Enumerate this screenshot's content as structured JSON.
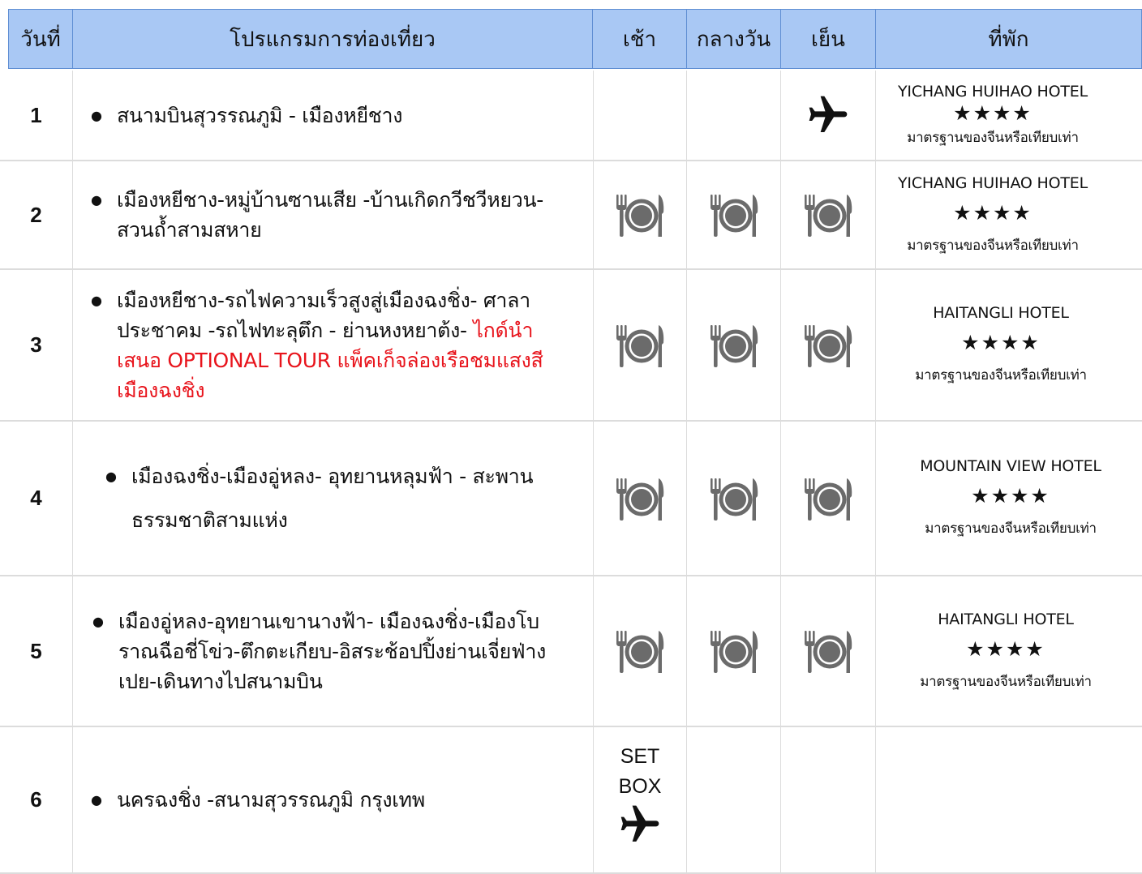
{
  "header": {
    "day": "วันที่",
    "program": "โปรแกรมการท่องเที่ยว",
    "breakfast": "เช้า",
    "lunch": "กลางวัน",
    "dinner": "เย็น",
    "accommodation": "ที่พัก"
  },
  "bullet": "●",
  "stars": "★★★★",
  "icons": {
    "meal": "plate-cutlery-icon",
    "flight": "airplane-icon"
  },
  "rows": [
    {
      "day": "1",
      "program": "สนามบินสุวรรณภูมิ - เมืองหยีชาง",
      "program_highlight": "",
      "meals": [
        "",
        "",
        "airplane-icon"
      ],
      "hotel": {
        "name": "YICHANG HUIHAO HOTEL",
        "standard": "มาตรฐานของจีนหรือเทียบเท่า"
      }
    },
    {
      "day": "2",
      "program": "เมืองหยีชาง-หมู่บ้านซานเสีย -บ้านเกิดกวีชวีหยวน-สวนถ้ำสามสหาย",
      "program_highlight": "",
      "meals": [
        "plate-cutlery-icon",
        "plate-cutlery-icon",
        "plate-cutlery-icon"
      ],
      "hotel": {
        "name": "YICHANG HUIHAO HOTEL",
        "standard": "มาตรฐานของจีนหรือเทียบเท่า"
      }
    },
    {
      "day": "3",
      "program": "เมืองหยีชาง-รถไฟความเร็วสูงสู่เมืองฉงชิ่ง- ศาลาประชาคม -รถไฟทะลุตึก - ย่านหงหยาต้ง- ",
      "program_highlight": "ไกด์นำเสนอ OPTIONAL TOUR แพ็คเก็จล่องเรือชมแสงสีเมืองฉงชิ่ง",
      "meals": [
        "plate-cutlery-icon",
        "plate-cutlery-icon",
        "plate-cutlery-icon"
      ],
      "hotel": {
        "name": "HAITANGLI HOTEL",
        "standard": "มาตรฐานของจีนหรือเทียบเท่า"
      }
    },
    {
      "day": "4",
      "program": "เมืองฉงชิ่ง-เมืองอู่หลง- อุทยานหลุมฟ้า - สะพานธรรมชาติสามแห่ง",
      "program_highlight": "",
      "meals": [
        "plate-cutlery-icon",
        "plate-cutlery-icon",
        "plate-cutlery-icon"
      ],
      "hotel": {
        "name": "MOUNTAIN VIEW HOTEL",
        "standard": "มาตรฐานของจีนหรือเทียบเท่า"
      }
    },
    {
      "day": "5",
      "program": "เมืองอู่หลง-อุทยานเขานางฟ้า- เมืองฉงชิ่ง-เมืองโบราณฉือชี่โข่ว-ตึกตะเกียบ-อิสระช้อปปิ้งย่านเจี่ยฟ่างเปย-เดินทางไปสนามบิน",
      "program_highlight": "",
      "meals": [
        "plate-cutlery-icon",
        "plate-cutlery-icon",
        "plate-cutlery-icon"
      ],
      "hotel": {
        "name": "HAITANGLI HOTEL",
        "standard": "มาตรฐานของจีนหรือเทียบเท่า"
      }
    },
    {
      "day": "6",
      "program": "นครฉงชิ่ง -สนามสุวรรณภูมิ กรุงเทพ",
      "program_highlight": "",
      "breakfast_lines": [
        "SET",
        "BOX"
      ],
      "meals": [
        "airplane-icon",
        "",
        ""
      ],
      "hotel": {
        "name": "",
        "standard": ""
      }
    }
  ]
}
